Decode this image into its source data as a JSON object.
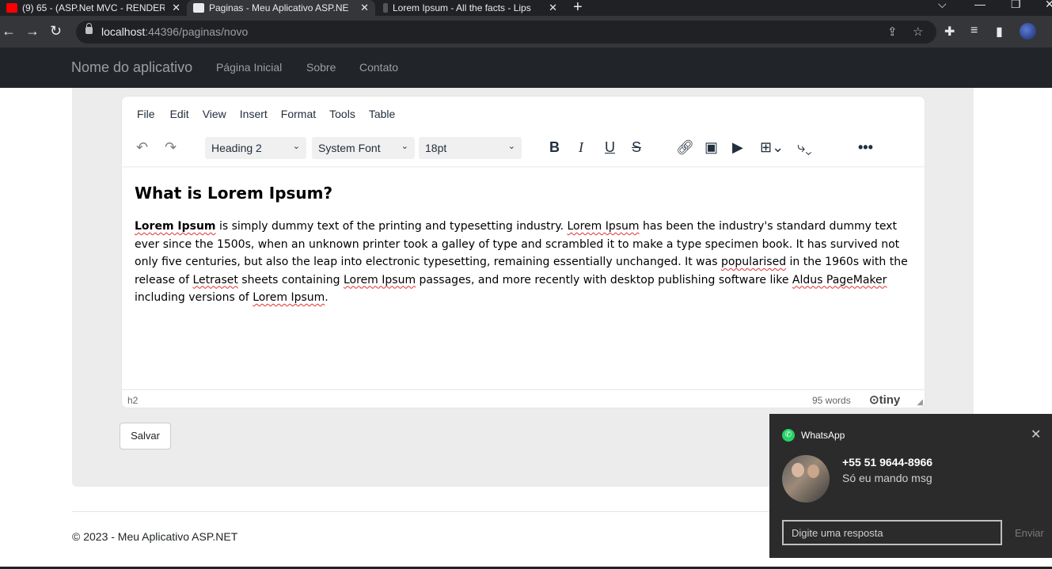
{
  "browser": {
    "tabs": [
      {
        "title": "(9) 65 - (ASP.Net MVC - RENDER",
        "favicon": "youtube-icon"
      },
      {
        "title": "Paginas - Meu Aplicativo ASP.NE",
        "favicon": "page-icon"
      },
      {
        "title": "Lorem Ipsum - All the facts - Lips",
        "favicon": "lipsum-icon"
      }
    ],
    "url_host": "localhost",
    "url_path": ":44396/paginas/novo"
  },
  "site": {
    "brand": "Nome do aplicativo",
    "nav": [
      "Página Inicial",
      "Sobre",
      "Contato"
    ]
  },
  "editor": {
    "menu": [
      "File",
      "Edit",
      "View",
      "Insert",
      "Format",
      "Tools",
      "Table"
    ],
    "block_format": "Heading 2",
    "font_family": "System Font",
    "font_size": "18pt",
    "heading": "What is Lorem Ipsum?",
    "paragraph": {
      "lead": "Lorem Ipsum",
      "t1": " is simply dummy text of the printing and typesetting industry. ",
      "w1": "Lorem Ipsum",
      "t2": " has been the industry's standard dummy text ever since the 1500s, when an unknown printer took a galley of type and scrambled it to make a type specimen book. It has survived not only five centuries, but also the leap into electronic typesetting, remaining essentially unchanged. It was ",
      "w2": "popularised",
      "t3": " in the 1960s with the release of ",
      "w3": "Letraset",
      "t4": " sheets containing ",
      "w4": "Lorem Ipsum",
      "t5": " passages, and more recently with desktop publishing software like ",
      "w5": "Aldus PageMaker",
      "t6": " including versions of ",
      "w6": "Lorem Ipsum",
      "t7": "."
    },
    "status_path": "h2",
    "word_count": "95 words",
    "logo": "tiny"
  },
  "save_button": "Salvar",
  "footer": "© 2023 - Meu Aplicativo ASP.NET",
  "notification": {
    "app": "WhatsApp",
    "sender": "+55 51 9644-8966",
    "message": "Só eu mando msg",
    "reply_placeholder": "Digite uma resposta",
    "send_label": "Enviar",
    "accent": "#25d366"
  }
}
